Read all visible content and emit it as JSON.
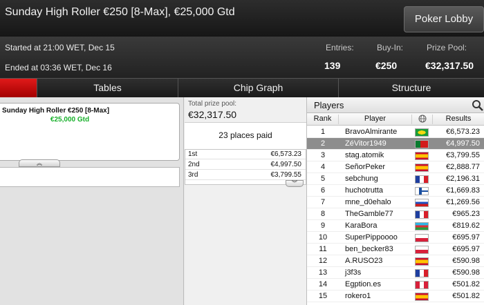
{
  "window": {
    "title": "Sunday High Roller €250 [8-Max], €25,000 Gtd",
    "lobby_button": "Poker Lobby"
  },
  "info": {
    "started": "Started at 21:00 WET, Dec 15",
    "ended": "Ended at 03:36 WET, Dec 16",
    "entries_label": "Entries:",
    "entries_value": "139",
    "buyin_label": "Buy-In:",
    "buyin_value": "€250",
    "prizepool_label": "Prize Pool:",
    "prizepool_value": "€32,317.50"
  },
  "tabs": [
    "Tables",
    "Chip Graph",
    "Structure"
  ],
  "tournament_card": {
    "name": "Sunday High Roller €250 [8-Max]",
    "guarantee": "€25,000 Gtd"
  },
  "prize": {
    "label": "Total prize pool:",
    "value": "€32,317.50",
    "places_paid": "23 places paid",
    "payouts": [
      {
        "place": "1st",
        "amount": "€6,573.23"
      },
      {
        "place": "2nd",
        "amount": "€4,997.50"
      },
      {
        "place": "3rd",
        "amount": "€3,799.55"
      }
    ]
  },
  "players": {
    "title": "Players",
    "columns": {
      "rank": "Rank",
      "player": "Player",
      "results": "Results"
    },
    "flag_colors": {
      "BR": [
        "#1a9c38",
        "#f5d90f"
      ],
      "PT": [
        "#0a7a2e",
        "#d21c1c"
      ],
      "ES": [
        "#c8102e",
        "#ffc400"
      ],
      "FR": [
        "#1f3fa0",
        "#ffffff",
        "#d81f2a"
      ],
      "FI": [
        "#ffffff",
        "#1a4fa0"
      ],
      "RU": [
        "#ffffff",
        "#1f4fbf",
        "#d21c1c"
      ],
      "AZ": [
        "#2eb5e6",
        "#e02b33",
        "#2a9a3c"
      ],
      "PL": [
        "#ffffff",
        "#d8203a"
      ],
      "CA": [
        "#d8203a",
        "#ffffff"
      ]
    },
    "rows": [
      {
        "rank": "1",
        "name": "BravoAlmirante",
        "flag": "BR",
        "result": "€6,573.23",
        "selected": false
      },
      {
        "rank": "2",
        "name": "ZéVitor1949",
        "flag": "PT",
        "result": "€4,997.50",
        "selected": true
      },
      {
        "rank": "3",
        "name": "stag.atomik",
        "flag": "ES",
        "result": "€3,799.55",
        "selected": false
      },
      {
        "rank": "4",
        "name": "SeñorPeker",
        "flag": "ES",
        "result": "€2,888.77",
        "selected": false
      },
      {
        "rank": "5",
        "name": "sebchung",
        "flag": "FR",
        "result": "€2,196.31",
        "selected": false
      },
      {
        "rank": "6",
        "name": "huchotrutta",
        "flag": "FI",
        "result": "€1,669.83",
        "selected": false
      },
      {
        "rank": "7",
        "name": "mne_d0ehalo",
        "flag": "RU",
        "result": "€1,269.56",
        "selected": false
      },
      {
        "rank": "8",
        "name": "TheGamble77",
        "flag": "FR",
        "result": "€965.23",
        "selected": false
      },
      {
        "rank": "9",
        "name": "KaraBora",
        "flag": "AZ",
        "result": "€819.62",
        "selected": false
      },
      {
        "rank": "10",
        "name": "SuperPippoooo",
        "flag": "PL",
        "result": "€695.97",
        "selected": false
      },
      {
        "rank": "11",
        "name": "ben_becker83",
        "flag": "PL",
        "result": "€695.97",
        "selected": false
      },
      {
        "rank": "12",
        "name": "A.RUSO23",
        "flag": "ES",
        "result": "€590.98",
        "selected": false
      },
      {
        "rank": "13",
        "name": "j3f3s",
        "flag": "FR",
        "result": "€590.98",
        "selected": false
      },
      {
        "rank": "14",
        "name": "Egption.es",
        "flag": "CA",
        "result": "€501.82",
        "selected": false
      },
      {
        "rank": "15",
        "name": "rokero1",
        "flag": "ES",
        "result": "€501.82",
        "selected": false
      }
    ]
  }
}
